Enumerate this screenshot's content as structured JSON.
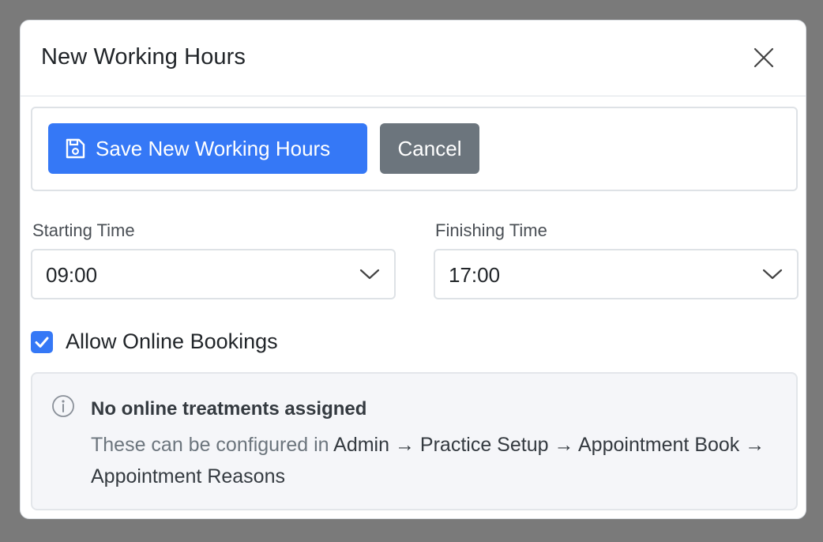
{
  "modal": {
    "title": "New Working Hours"
  },
  "toolbar": {
    "save_label": "Save New Working Hours",
    "cancel_label": "Cancel"
  },
  "form": {
    "starting_time": {
      "label": "Starting Time",
      "value": "09:00"
    },
    "finishing_time": {
      "label": "Finishing Time",
      "value": "17:00"
    },
    "allow_online": {
      "label": "Allow Online Bookings",
      "checked": true
    }
  },
  "info": {
    "title": "No online treatments assigned",
    "text_prefix": "These can be configured in ",
    "path": "Admin → Practice Setup → Appointment Book → Appointment Reasons"
  },
  "colors": {
    "primary": "#3578f6",
    "secondary": "#6c757d",
    "backdrop": "#7a7a7a"
  },
  "icons": {
    "close": "close-icon",
    "save": "save-icon",
    "chevron": "chevron-down-icon",
    "check": "check-icon",
    "info": "info-icon"
  }
}
